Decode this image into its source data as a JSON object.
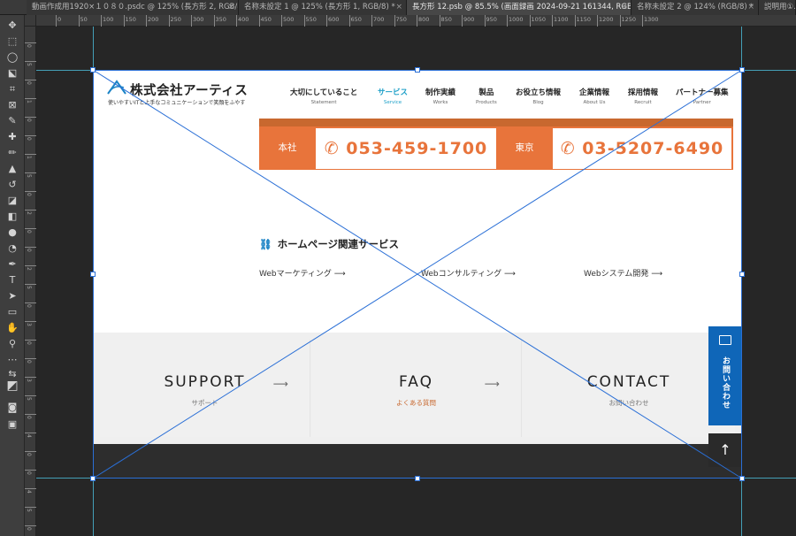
{
  "tabs": [
    {
      "label": "動画作成用1920×１０８０.psdc @ 125% (長方形 2, RGB/8)",
      "active": false
    },
    {
      "label": "名称未設定 1 @ 125% (長方形 1, RGB/8) *",
      "active": false
    },
    {
      "label": "長方形 12.psb @ 85.5% (画面録画 2024-09-21 161344, RGB/8) *",
      "active": true
    },
    {
      "label": "名称未設定 2 @ 124% (RGB/8) *",
      "active": false
    },
    {
      "label": "説明用①.",
      "active": false
    }
  ],
  "ruler_top": [
    "0",
    "50",
    "100",
    "150",
    "200",
    "250",
    "300",
    "350",
    "400",
    "450",
    "500",
    "550",
    "600",
    "650",
    "700",
    "750",
    "800",
    "850",
    "900",
    "950",
    "1000",
    "1050",
    "1100",
    "1150",
    "1200",
    "1250",
    "1300"
  ],
  "ruler_left": [
    "0",
    "5",
    "0",
    "1",
    "0",
    "0",
    "1",
    "5",
    "0",
    "2",
    "0",
    "0",
    "2",
    "5",
    "0",
    "3",
    "0",
    "0",
    "3",
    "5",
    "0",
    "4",
    "0",
    "0",
    "4",
    "5",
    "0"
  ],
  "site": {
    "logo_name": "株式会社アーティス",
    "logo_tagline": "使いやすいITと上手なコミュニケーションで笑顔をふやす",
    "nav": [
      {
        "jp": "大切にしていること",
        "en": "Statement",
        "active": false
      },
      {
        "jp": "サービス",
        "en": "Service",
        "active": true
      },
      {
        "jp": "制作実績",
        "en": "Works",
        "active": false
      },
      {
        "jp": "製品",
        "en": "Products",
        "active": false
      },
      {
        "jp": "お役立ち情報",
        "en": "Blog",
        "active": false
      },
      {
        "jp": "企業情報",
        "en": "About Us",
        "active": false
      },
      {
        "jp": "採用情報",
        "en": "Recruit",
        "active": false
      },
      {
        "jp": "パートナー募集",
        "en": "Partner",
        "active": false
      }
    ],
    "phones": [
      {
        "label": "本社",
        "number": "053-459-1700"
      },
      {
        "label": "東京",
        "number": "03-5207-6490"
      }
    ],
    "service_title": "ホームページ関連サービス",
    "service_links": [
      "Webマーケティング ⟶",
      "Webコンサルティング ⟶",
      "Webシステム開発 ⟶"
    ],
    "cards": [
      {
        "title": "SUPPORT",
        "sub": "サポート"
      },
      {
        "title": "FAQ",
        "sub": "よくある質問"
      },
      {
        "title": "CONTACT",
        "sub": "お問い合わせ"
      }
    ],
    "contact_tab": "お問い合わせ",
    "top_arrow": "↑"
  },
  "colors": {
    "accent_orange": "#e8743b",
    "nav_active": "#1ea0c8",
    "contact_blue": "#0f66b8",
    "guide": "#4fc8e8"
  }
}
